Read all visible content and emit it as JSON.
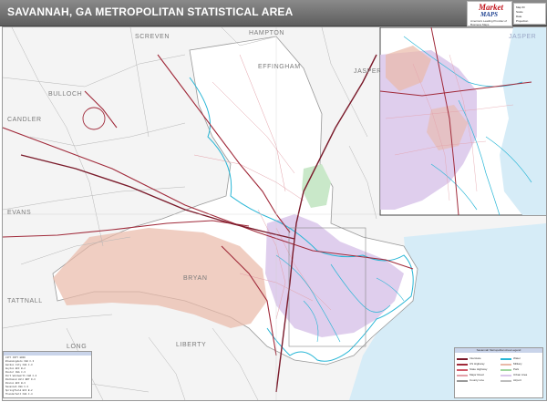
{
  "header": {
    "title": "SAVANNAH, GA METROPOLITAN STATISTICAL AREA"
  },
  "logo": {
    "brand_line1": "Market",
    "brand_line2": "MAPS",
    "tagline": "America's Leading Provider of Business Maps"
  },
  "publisher_info": {
    "lines": [
      "Map ID",
      "Scale",
      "Date",
      "Projection"
    ]
  },
  "map": {
    "county_labels": [
      "SCREVEN",
      "HAMPTON",
      "EFFINGHAM",
      "JASPER",
      "BULLOCH",
      "BRYAN",
      "TATTNALL",
      "LONG",
      "LIBERTY",
      "EVANS",
      "CANDLER"
    ],
    "inset_labels": [
      "JASPER"
    ],
    "colors": {
      "water": "#d6ecf7",
      "coast": "#28b6d6",
      "metro_area": "#ffffff",
      "outside": "#f2f2f2",
      "urban_purple": "#d9c6ea",
      "urban_pink": "#f2c4c4",
      "military_tan": "#e9b9a8",
      "green_park": "#c9e8c9",
      "interstate": "#7a1a2a",
      "highway": "#a02a3a",
      "county_line": "#bbbbbb",
      "road": "#e3a0a8"
    }
  },
  "legend": {
    "title": "Savannah Metropolitan Area Legend",
    "items": [
      {
        "label": "Interstate",
        "color": "#7a1a2a"
      },
      {
        "label": "US Highway",
        "color": "#a02a3a"
      },
      {
        "label": "State Highway",
        "color": "#d05a6a"
      },
      {
        "label": "Major Road",
        "color": "#e3a0a8"
      },
      {
        "label": "County Line",
        "color": "#999999"
      },
      {
        "label": "Water",
        "color": "#28b6d6"
      },
      {
        "label": "Military",
        "color": "#e9b9a8"
      },
      {
        "label": "Park",
        "color": "#9fd69f"
      },
      {
        "label": "Urban Area",
        "color": "#d9c6ea"
      },
      {
        "label": "Airport",
        "color": "#bdbdbd"
      }
    ]
  },
  "index": {
    "rows": [
      "CITY          CNTY   GRID",
      "Bloomingdale  CHA    C-3",
      "Garden City   CHA    C-3",
      "Guyton        EFF    B-2",
      "Pooler        CHA    C-3",
      "Port Wentworth CHA   C-3",
      "Richmond Hill BRY    D-3",
      "Rincon        EFF    B-3",
      "Savannah      CHA    C-3",
      "Springfield   EFF    B-2",
      "Thunderbolt   CHA    C-4",
      "Tybee Island  CHA    C-5"
    ]
  }
}
